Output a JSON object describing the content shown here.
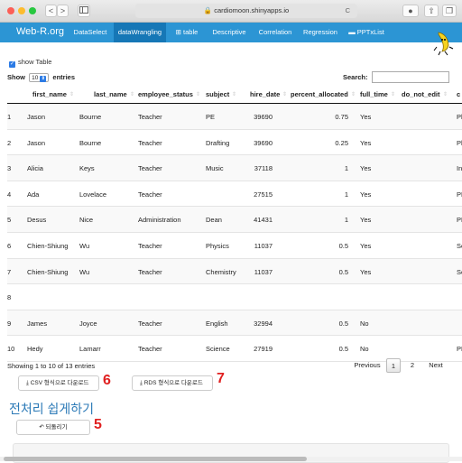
{
  "browser": {
    "url": "cardiomoon.shinyapps.io",
    "back": "<",
    "forward": ">",
    "sidebar_icon": "sidebar-icon",
    "reload_icon": "C"
  },
  "navbar": {
    "brand": "Web-R.org",
    "tabs": [
      "DataSelect",
      "dataWrangling",
      "⊞ table",
      "Descriptive",
      "Correlation",
      "Regression",
      "▬ PPTxList"
    ],
    "active_tab": "dataWrangling"
  },
  "controls": {
    "show_table_label": "show Table",
    "show": "Show",
    "entries_value": "10",
    "entries": "entries",
    "search_label": "Search:",
    "search_value": ""
  },
  "table": {
    "columns": [
      "first_name",
      "last_name",
      "employee_status",
      "subject",
      "hire_date",
      "percent_allocated",
      "full_time",
      "do_not_edit",
      "c"
    ],
    "rows": [
      [
        "1",
        "Jason",
        "Bourne",
        "Teacher",
        "PE",
        "39690",
        "0.75",
        "Yes",
        "",
        "Ph"
      ],
      [
        "2",
        "Jason",
        "Bourne",
        "Teacher",
        "Drafting",
        "39690",
        "0.25",
        "Yes",
        "",
        "Ph"
      ],
      [
        "3",
        "Alicia",
        "Keys",
        "Teacher",
        "Music",
        "37118",
        "1",
        "Yes",
        "",
        "Ins"
      ],
      [
        "4",
        "Ada",
        "Lovelace",
        "Teacher",
        "",
        "27515",
        "1",
        "Yes",
        "",
        "PE"
      ],
      [
        "5",
        "Desus",
        "Nice",
        "Administration",
        "Dean",
        "41431",
        "1",
        "Yes",
        "",
        "PE"
      ],
      [
        "6",
        "Chien-Shiung",
        "Wu",
        "Teacher",
        "Physics",
        "11037",
        "0.5",
        "Yes",
        "",
        "Sc"
      ],
      [
        "7",
        "Chien-Shiung",
        "Wu",
        "Teacher",
        "Chemistry",
        "11037",
        "0.5",
        "Yes",
        "",
        "Sc"
      ],
      [
        "8",
        "",
        "",
        "",
        "",
        "",
        "",
        "",
        "",
        ""
      ],
      [
        "9",
        "James",
        "Joyce",
        "Teacher",
        "English",
        "32994",
        "0.5",
        "No",
        "",
        ""
      ],
      [
        "10",
        "Hedy",
        "Lamarr",
        "Teacher",
        "Science",
        "27919",
        "0.5",
        "No",
        "",
        "PE"
      ]
    ]
  },
  "footer": {
    "info": "Showing 1 to 10 of 13 entries",
    "previous": "Previous",
    "pages": [
      "1",
      "2"
    ],
    "next": "Next"
  },
  "downloads": {
    "csv": "CSV 형식으로 다운로드",
    "rds": "RDS 형식으로 다운로드",
    "csv_marker": "6",
    "rds_marker": "7"
  },
  "section": {
    "title": "전처리 쉽게하기",
    "undo": "되돌리기",
    "undo_marker": "5"
  },
  "colors": {
    "navbar": "#2c95d4",
    "active_tab": "#1677b6",
    "heading": "#2c7ab7",
    "marker": "#e02020"
  }
}
